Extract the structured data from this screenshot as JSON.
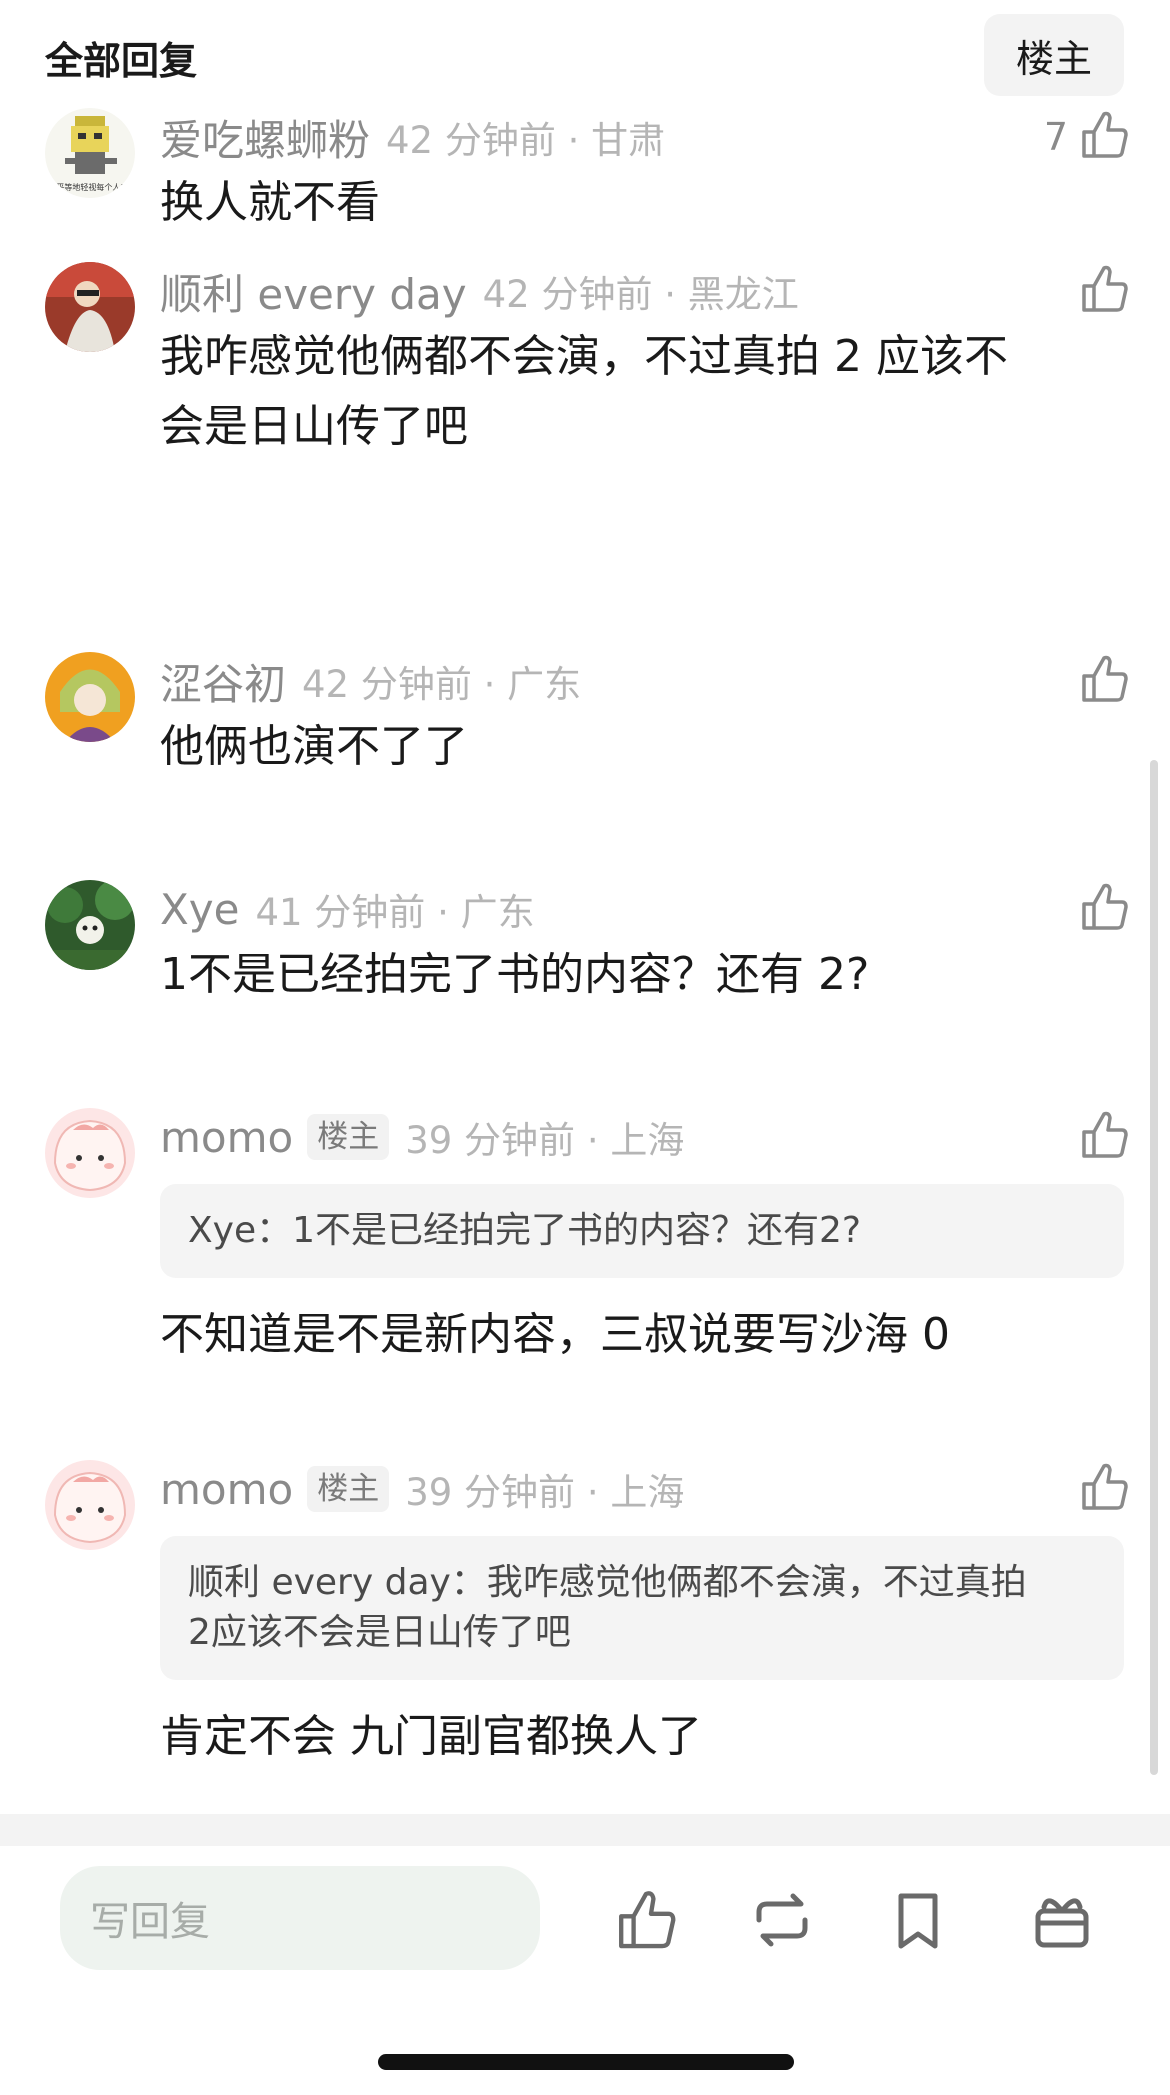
{
  "header": {
    "title": "全部回复",
    "owner_filter": "楼主"
  },
  "comments": [
    {
      "username": "爱吃螺蛳粉",
      "time_location": "42 分钟前 · 甘肃",
      "likes": "7",
      "text_lines": [
        "换人就不看"
      ],
      "avatar_text": "平等地轻视每个人!"
    },
    {
      "username": "顺利 every day",
      "time_location": "42 分钟前 · 黑龙江",
      "likes": "",
      "text_lines": [
        "我咋感觉他俩都不会演，不过真拍 2 应该不",
        "会是日山传了吧"
      ]
    },
    {
      "username": "涩谷初",
      "time_location": "42 分钟前 · 广东",
      "likes": "",
      "text_lines": [
        "他俩也演不了了"
      ]
    },
    {
      "username": "Xye",
      "time_location": "41 分钟前 · 广东",
      "likes": "",
      "text_lines": [
        "1不是已经拍完了书的内容？还有 2?"
      ]
    },
    {
      "username": "momo",
      "op_tag": "楼主",
      "time_location": "39 分钟前 · 上海",
      "likes": "",
      "quote_lines": [
        "Xye：1不是已经拍完了书的内容？还有2?"
      ],
      "text_lines": [
        "不知道是不是新内容，三叔说要写沙海 0"
      ]
    },
    {
      "username": "momo",
      "op_tag": "楼主",
      "time_location": "39 分钟前 · 上海",
      "likes": "",
      "quote_lines": [
        "顺利 every day：我咋感觉他俩都不会演，不过真拍",
        "2应该不会是日山传了吧"
      ],
      "text_lines": [
        "肯定不会   九门副官都换人了"
      ]
    }
  ],
  "bottom_bar": {
    "reply_placeholder": "写回复",
    "icons": [
      "thumbs-up-icon",
      "repost-icon",
      "bookmark-icon",
      "gift-icon"
    ]
  },
  "colors": {
    "text": "#1a1a1a",
    "meta": "#8a8a8a",
    "time": "#b5b5b5",
    "quote_bg": "#f4f4f4",
    "reply_bg": "#eef3ef"
  }
}
